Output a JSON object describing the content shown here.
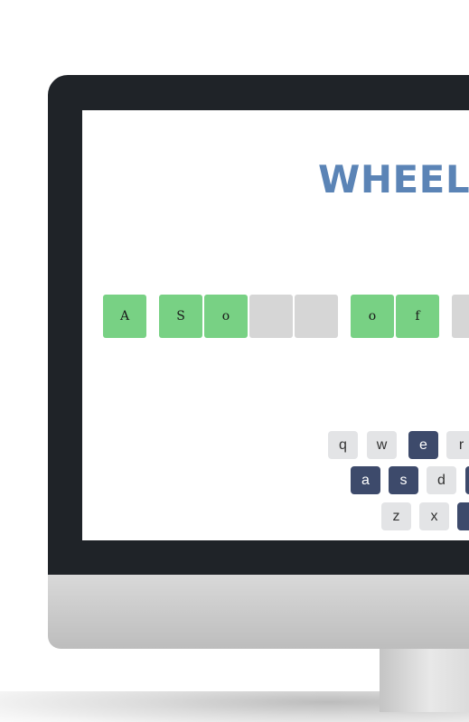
{
  "game": {
    "title": "WHEEL",
    "tiles": [
      {
        "letter": "A",
        "state": "correct"
      },
      {
        "letter": "S",
        "state": "correct"
      },
      {
        "letter": "o",
        "state": "correct"
      },
      {
        "letter": "",
        "state": "empty"
      },
      {
        "letter": "",
        "state": "empty"
      },
      {
        "letter": "o",
        "state": "correct"
      },
      {
        "letter": "f",
        "state": "correct"
      },
      {
        "letter": "",
        "state": "empty"
      }
    ],
    "keyboard": {
      "row1": [
        {
          "key": "q",
          "state": "unused"
        },
        {
          "key": "w",
          "state": "unused"
        },
        {
          "key": "e",
          "state": "used"
        },
        {
          "key": "r",
          "state": "unused"
        }
      ],
      "row2": [
        {
          "key": "a",
          "state": "used"
        },
        {
          "key": "s",
          "state": "used"
        },
        {
          "key": "d",
          "state": "unused"
        },
        {
          "key": "",
          "state": "used"
        }
      ],
      "row3": [
        {
          "key": "z",
          "state": "unused"
        },
        {
          "key": "x",
          "state": "unused"
        },
        {
          "key": "",
          "state": "used"
        }
      ]
    }
  },
  "colors": {
    "title": "#5b84b6",
    "tile_correct": "#78d184",
    "tile_empty": "#d6d6d6",
    "key_unused": "#e3e4e6",
    "key_used": "#3d4a6b",
    "bezel": "#1f2328"
  }
}
